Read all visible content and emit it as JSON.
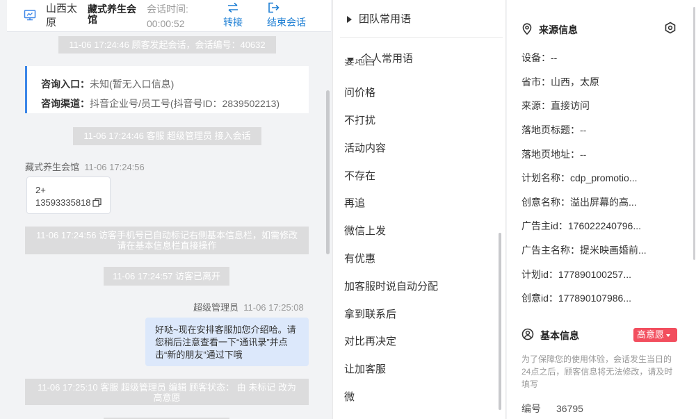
{
  "header": {
    "location": "山西太原",
    "customer_name": "藏式养生会馆",
    "session_time_label": "会话时间:",
    "session_time": "00:00:52",
    "transfer_label": "转接",
    "end_label": "结束会话"
  },
  "chat": {
    "sys_start": "11-06 17:24:46 顾客发起会话，会话编号：40632",
    "info_entry_label": "咨询入口：",
    "info_entry_value": "未知(暂无入口信息)",
    "info_channel_label": "咨询渠道：",
    "info_channel_value": "抖音企业号/员工号(抖音号ID：2839502213)",
    "sys_join": "11-06 17:24:46 客服 超级管理员 接入会话",
    "customer_sender": "藏式养生会馆",
    "customer_time": "11-06 17:24:56",
    "phone_line1": "2+",
    "phone_line2": "13593335818",
    "sys_auto_mark": "11-06 17:24:56 访客手机号已自动标记右侧基本信息栏，如需修改请在基本信息栏直接操作",
    "sys_left": "11-06 17:24:57 访客已离开",
    "agent_sender": "超级管理员",
    "agent_time": "11-06 17:25:08",
    "agent_message": "好哒~现在安排客服加您介绍哈。请您稍后注意查看一下“通讯录”并点击“新的朋友”通过下哦",
    "sys_status_change": "11-06 17:25:10 客服 超级管理员 编辑 顾客状态： 由 未标记 改为 高意愿"
  },
  "phrases": {
    "team_group": "团队常用语",
    "personal_group": "个人常用语",
    "clipped_item": "要地吕",
    "items": [
      "问价格",
      "不打扰",
      "活动内容",
      "不存在",
      "再追",
      "微信上发",
      "有优惠",
      "加客服时说自动分配",
      "拿到联系后",
      "对比再决定",
      "让加客服",
      "微"
    ]
  },
  "source": {
    "title": "来源信息",
    "rows": [
      "设备：--",
      "省市：山西，太原",
      "来源：直接访问",
      "落地页标题：--",
      "落地页地址：--",
      "计划名称：cdp_promotio...",
      "创意名称：溢出屏幕的高...",
      "广告主id：176022240796...",
      "广告主名称：提米映画婚前...",
      "计划id：177890100257...",
      "创意id：177890107986..."
    ]
  },
  "basic": {
    "title": "基本信息",
    "badge": "高意愿",
    "notice": "为了保障您的使用体验，会话发生当日的24点之后，顾客信息将无法修改，请及时填写",
    "id_label": "编号",
    "id_value": "36795"
  },
  "colors": {
    "accent_blue": "#1e7fd4",
    "badge_red": "#f24e5e",
    "agent_bubble": "#dce8fb",
    "system_msg": "#dcdcdd"
  },
  "icons": {
    "monitor": "monitor-icon",
    "transfer": "transfer-arrows-icon",
    "end": "logout-icon",
    "copy": "copy-icon",
    "location": "location-pin-icon",
    "gear": "hex-settings-icon",
    "user": "user-circle-icon"
  }
}
